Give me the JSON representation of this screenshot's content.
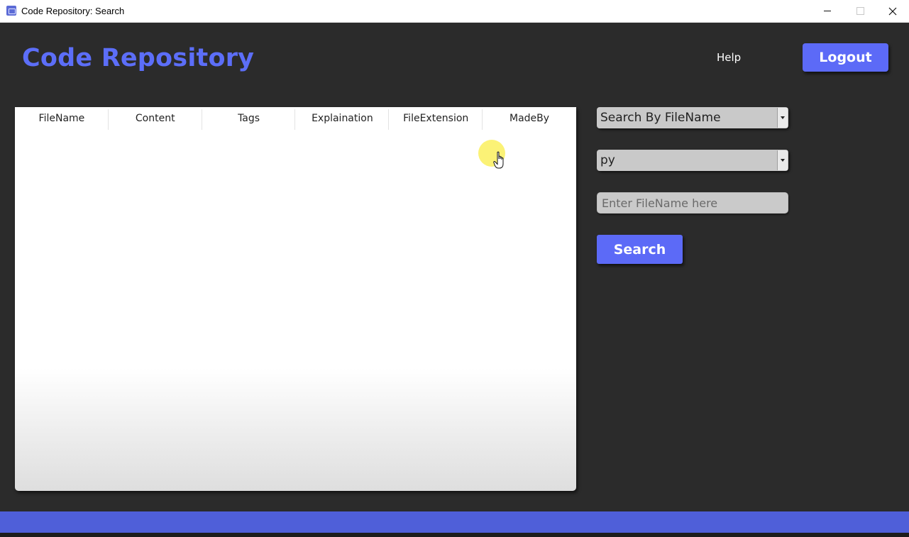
{
  "window": {
    "title": "Code Repository: Search",
    "controls": [
      "minimize",
      "maximize",
      "close"
    ]
  },
  "header": {
    "brand": "Code Repository",
    "help_label": "Help",
    "logout_label": "Logout"
  },
  "results_table": {
    "columns": [
      "FileName",
      "Content",
      "Tags",
      "Explaination",
      "FileExtension",
      "MadeBy"
    ],
    "rows": []
  },
  "search_panel": {
    "search_mode_selected": "Search By FileName",
    "extension_selected": "py",
    "filename_placeholder": "Enter FileName here",
    "filename_value": "",
    "search_label": "Search"
  },
  "colors": {
    "accent": "#5c6af7",
    "brand_text": "#5c6ef8",
    "background": "#2b2b2b",
    "footer": "#4f5fd9"
  },
  "icons": [
    "app-icon",
    "minimize-icon",
    "maximize-icon",
    "close-icon",
    "chevron-down-icon",
    "hand-cursor-icon"
  ]
}
